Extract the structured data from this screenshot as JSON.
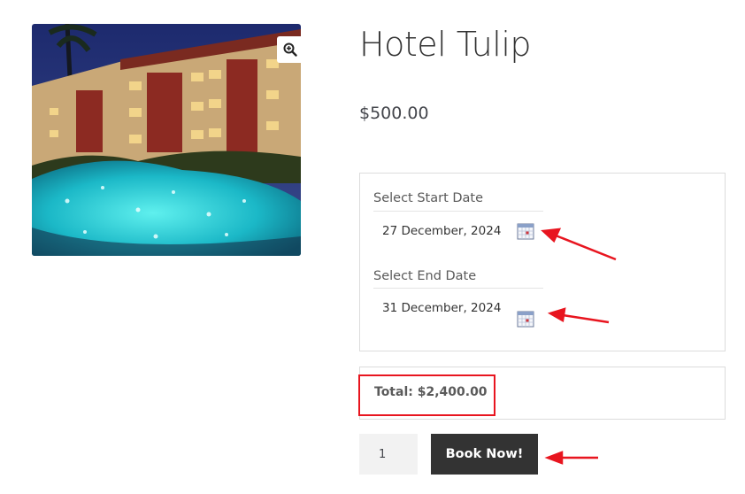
{
  "product": {
    "title": "Hotel Tulip",
    "price": "$500.00",
    "image": {
      "subject": "hotel-pool-night-photo"
    }
  },
  "booking": {
    "start_label": "Select Start Date",
    "start_value": "27 December, 2024",
    "end_label": "Select End Date",
    "end_value": "31 December, 2024"
  },
  "total": {
    "text": "Total: $2,400.00"
  },
  "cart": {
    "quantity": "1",
    "book_label": "Book Now!"
  },
  "colors": {
    "annotation": "#e8151f",
    "button_bg": "#333333",
    "title": "#333333"
  },
  "icons": [
    "zoom-in-icon",
    "calendar-icon"
  ]
}
